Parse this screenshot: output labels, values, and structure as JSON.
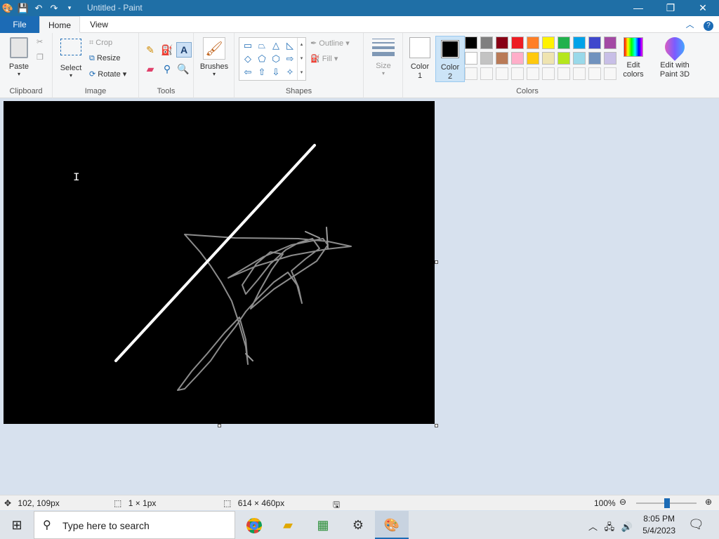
{
  "window": {
    "title": "Untitled - Paint",
    "minimize": "—",
    "maximize": "❐",
    "close": "✕"
  },
  "tabs": {
    "file": "File",
    "home": "Home",
    "view": "View"
  },
  "ribbon": {
    "clipboard": {
      "label": "Clipboard",
      "paste": "Paste"
    },
    "image": {
      "label": "Image",
      "select": "Select",
      "crop": "Crop",
      "resize": "Resize",
      "rotate": "Rotate"
    },
    "tools": {
      "label": "Tools"
    },
    "brushes": {
      "label": "Brushes"
    },
    "shapes": {
      "label": "Shapes",
      "outline": "Outline",
      "fill": "Fill"
    },
    "size": {
      "label": "Size"
    },
    "colors": {
      "label": "Colors",
      "color1": "Color 1",
      "color2": "Color 2",
      "edit_colors": "Edit colors",
      "edit_paint3d": "Edit with Paint 3D",
      "color1_value": "#ffffff",
      "color2_value": "#000000",
      "palette_row1": [
        "#000000",
        "#7f7f7f",
        "#880015",
        "#ed1c24",
        "#ff7f27",
        "#fff200",
        "#22b14c",
        "#00a2e8",
        "#3f48cc",
        "#a349a4"
      ],
      "palette_row2": [
        "#ffffff",
        "#c3c3c3",
        "#b97a57",
        "#ffaec9",
        "#ffc90e",
        "#efe4b0",
        "#b5e61d",
        "#99d9ea",
        "#7092be",
        "#c8bfe7"
      ]
    }
  },
  "status": {
    "cursor_pos": "102, 109px",
    "selection_size": "1 × 1px",
    "image_size": "614 × 460px",
    "zoom": "100%"
  },
  "taskbar": {
    "search_placeholder": "Type here to search",
    "time": "8:05 PM",
    "date": "5/4/2023"
  }
}
